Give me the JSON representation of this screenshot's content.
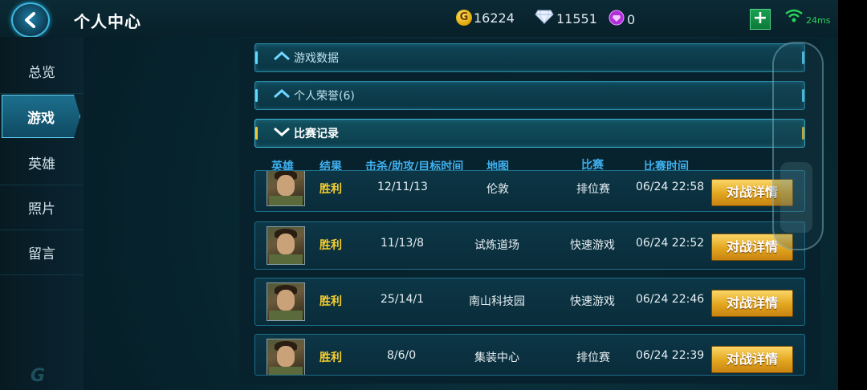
{
  "header": {
    "title": "个人中心",
    "gold": "16224",
    "diamonds": "11551",
    "gems": "0",
    "gold_symbol": "G",
    "add_label": "+",
    "ping": "24ms"
  },
  "sidebar": {
    "items": [
      {
        "label": "总览",
        "active": false
      },
      {
        "label": "游戏",
        "active": true
      },
      {
        "label": "英雄",
        "active": false
      },
      {
        "label": "照片",
        "active": false
      },
      {
        "label": "留言",
        "active": false
      }
    ],
    "logo": "G"
  },
  "sections": {
    "game_data": "游戏数据",
    "honors": "个人荣誉(6)",
    "match_records": "比赛记录"
  },
  "table": {
    "headers": {
      "hero": "英雄",
      "result": "结果",
      "kda": "击杀/助攻/目标时间",
      "map": "地图",
      "mode": "比赛",
      "time": "比赛时间"
    },
    "rows": [
      {
        "result": "胜利",
        "kda": "12/11/13",
        "map": "伦敦",
        "mode": "排位赛",
        "time": "06/24 22:58",
        "button": "对战详情"
      },
      {
        "result": "胜利",
        "kda": "11/13/8",
        "map": "试炼道场",
        "mode": "快速游戏",
        "time": "06/24 22:52",
        "button": "对战详情"
      },
      {
        "result": "胜利",
        "kda": "25/14/1",
        "map": "南山科技园",
        "mode": "快速游戏",
        "time": "06/24 22:46",
        "button": "对战详情"
      },
      {
        "result": "胜利",
        "kda": "8/6/0",
        "map": "集装中心",
        "mode": "排位赛",
        "time": "06/24 22:39",
        "button": "对战详情"
      }
    ]
  },
  "colors": {
    "accent": "#3fb0ef",
    "win": "#f7cf2e",
    "button": "#e2a51e"
  }
}
